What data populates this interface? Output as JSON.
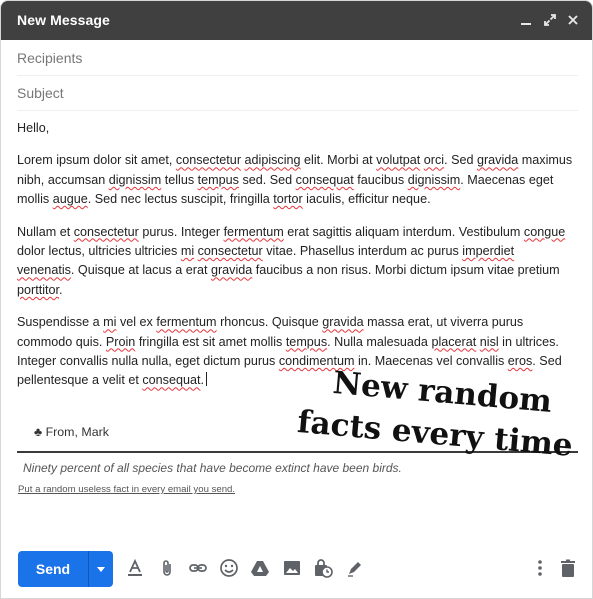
{
  "window": {
    "title": "New Message",
    "minimize_glyph": "_",
    "expand_glyph": "⤢",
    "close_glyph": "✕"
  },
  "fields": {
    "recipients_placeholder": "Recipients",
    "subject_placeholder": "Subject"
  },
  "body": {
    "greeting": "Hello,",
    "paragraphs": [
      "Lorem ipsum dolor sit amet, consectetur adipiscing elit. Morbi at volutpat orci. Sed gravida maximus nibh, accumsan dignissim tellus tempus sed. Sed consequat faucibus dignissim. Maecenas eget mollis augue. Sed nec lectus suscipit, fringilla tortor iaculis, efficitur neque.",
      "Nullam et consectetur purus. Integer fermentum erat sagittis aliquam interdum. Vestibulum congue dolor lectus, ultricies ultricies mi consectetur vitae. Phasellus interdum ac purus imperdiet venenatis. Quisque at lacus a erat gravida faucibus a non risus. Morbi dictum ipsum vitae pretium porttitor.",
      "Suspendisse a mi vel ex fermentum rhoncus. Quisque gravida massa erat, ut viverra purus commodo quis. Proin fringilla est sit amet mollis tempus. Nulla malesuada placerat nisl in ultrices. Integer convallis nulla nulla, eget dictum purus condimentum in. Maecenas vel convallis eros. Sed pellentesque a velit et consequat."
    ],
    "spell_flagged_words": [
      "consectetur",
      "adipiscing",
      "volutpat",
      "orci",
      "gravida",
      "dignissim",
      "tempus",
      "consequat",
      "augue",
      "tortor",
      "fermentum",
      "congue",
      "mi",
      "imperdiet",
      "venenatis",
      "porttitor",
      "Proin",
      "placerat",
      "nisl",
      "condimentum",
      "eros"
    ]
  },
  "signature": {
    "symbol": "♣",
    "text": "From, Mark"
  },
  "fact": {
    "text": "Ninety percent of all species that have become extinct have been birds.",
    "link": "Put a random useless fact in every email you send."
  },
  "annotation": {
    "line1": "New random",
    "line2": "facts every time"
  },
  "toolbar": {
    "send_label": "Send",
    "icons": [
      "formatting-icon",
      "attach-icon",
      "link-icon",
      "emoji-icon",
      "drive-icon",
      "photo-icon",
      "confidential-icon",
      "signature-icon",
      "more-options-icon",
      "discard-icon"
    ]
  },
  "colors": {
    "titlebar": "#404040",
    "send_button": "#1a73e8",
    "spellcheck_underline": "#e5343a"
  }
}
